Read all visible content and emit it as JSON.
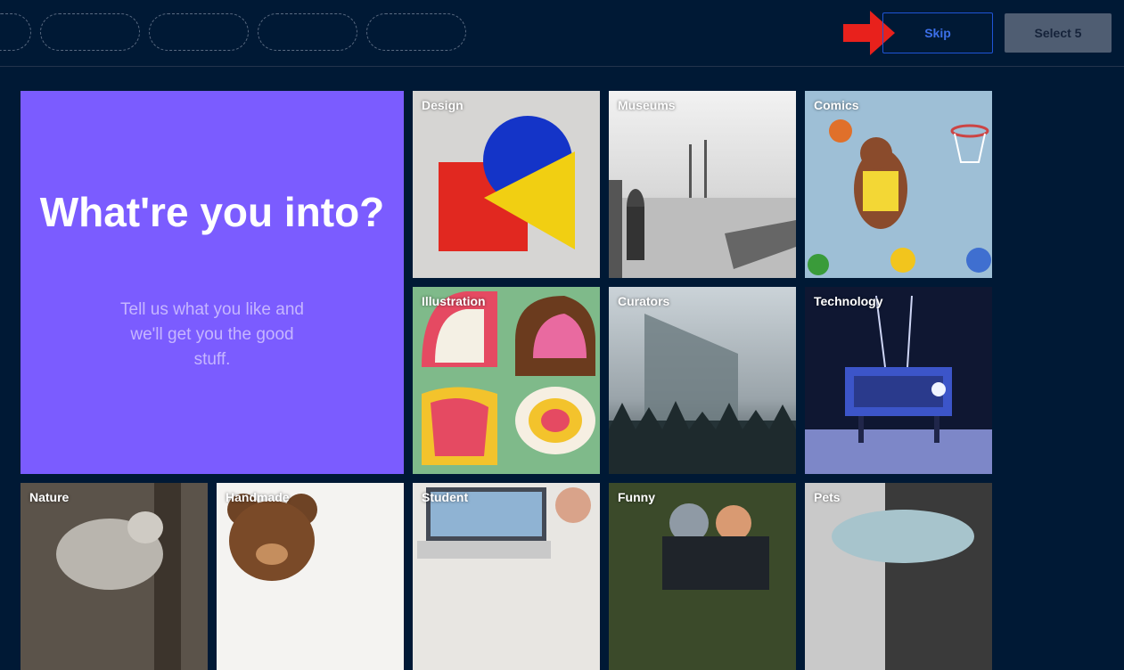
{
  "header": {
    "skip_label": "Skip",
    "select_label": "Select 5"
  },
  "hero": {
    "title": "What're you into?",
    "subtitle": "Tell us what you like and we'll get you the good stuff."
  },
  "tiles": [
    {
      "label": "Design"
    },
    {
      "label": "Museums"
    },
    {
      "label": "Comics"
    },
    {
      "label": "Illustration"
    },
    {
      "label": "Curators"
    },
    {
      "label": "Technology"
    },
    {
      "label": "Nature"
    },
    {
      "label": "Handmade"
    },
    {
      "label": "Student"
    },
    {
      "label": "Funny"
    },
    {
      "label": "Pets"
    }
  ],
  "colors": {
    "background": "#001935",
    "accent": "#7b5cff",
    "skip_blue": "#1f54d6",
    "arrow_red": "#e8211c"
  }
}
